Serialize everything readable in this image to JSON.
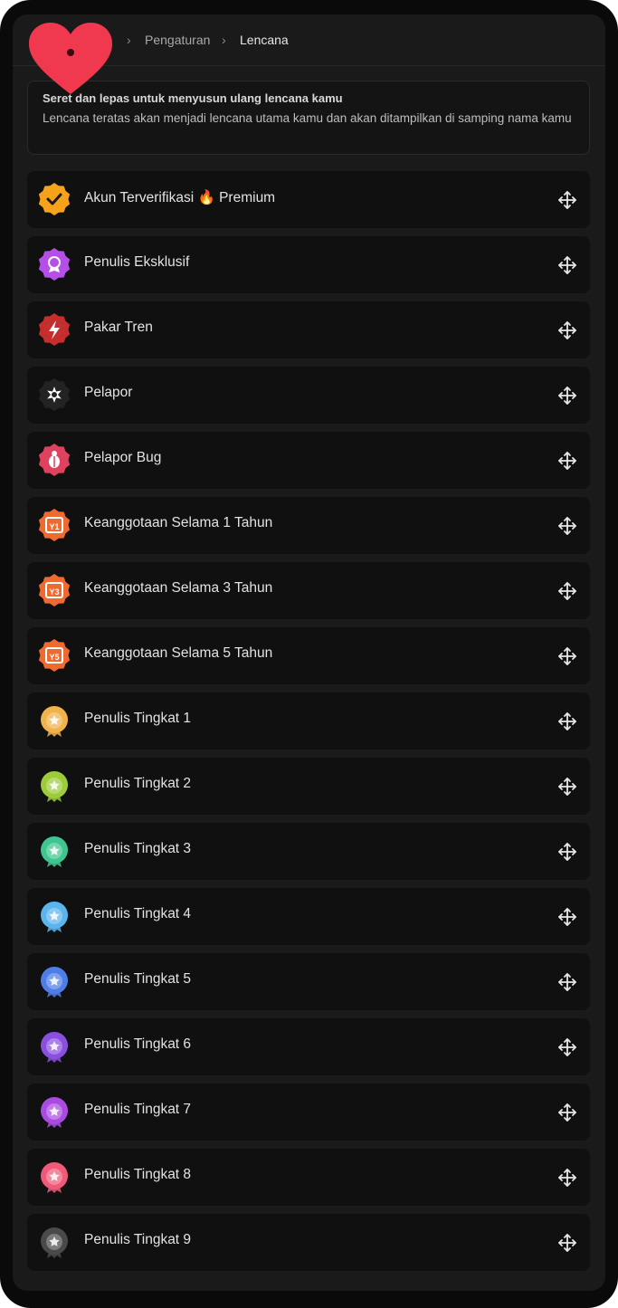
{
  "breadcrumb": {
    "home_icon": "heart-icon",
    "items": [
      "Pengaturan",
      "Lencana"
    ]
  },
  "info": {
    "title": "Seret dan lepas untuk menyusun ulang lencana kamu",
    "description": "Lencana teratas akan menjadi lencana utama kamu dan akan ditampilkan di samping nama kamu"
  },
  "badges": [
    {
      "label": "Akun Terverifikasi 🔥 Premium",
      "icon": "verified-badge-icon",
      "color": "#f7a21b"
    },
    {
      "label": "Penulis Eksklusif",
      "icon": "exclusive-writer-badge-icon",
      "color": "#b64ee8"
    },
    {
      "label": "Pakar Tren",
      "icon": "trend-expert-badge-icon",
      "color": "#c62d2d"
    },
    {
      "label": "Pelapor",
      "icon": "reporter-badge-icon",
      "color": "#232323"
    },
    {
      "label": "Pelapor Bug",
      "icon": "bug-reporter-badge-icon",
      "color": "#e0415e"
    },
    {
      "label": "Keanggotaan Selama 1 Tahun",
      "icon": "membership-1-year-badge-icon",
      "color": "#ee6a30",
      "short": "Y1"
    },
    {
      "label": "Keanggotaan Selama 3 Tahun",
      "icon": "membership-3-year-badge-icon",
      "color": "#ee6a30",
      "short": "Y3"
    },
    {
      "label": "Keanggotaan Selama 5 Tahun",
      "icon": "membership-5-year-badge-icon",
      "color": "#ee6a30",
      "short": "Y5"
    },
    {
      "label": "Penulis Tingkat 1",
      "icon": "writer-level-1-badge-icon",
      "color": "#f0b24a"
    },
    {
      "label": "Penulis Tingkat 2",
      "icon": "writer-level-2-badge-icon",
      "color": "#9ccc3a"
    },
    {
      "label": "Penulis Tingkat 3",
      "icon": "writer-level-3-badge-icon",
      "color": "#3fc58f"
    },
    {
      "label": "Penulis Tingkat 4",
      "icon": "writer-level-4-badge-icon",
      "color": "#5ab4ee"
    },
    {
      "label": "Penulis Tingkat 5",
      "icon": "writer-level-5-badge-icon",
      "color": "#4f7de8"
    },
    {
      "label": "Penulis Tingkat 6",
      "icon": "writer-level-6-badge-icon",
      "color": "#8b4fe0"
    },
    {
      "label": "Penulis Tingkat 7",
      "icon": "writer-level-7-badge-icon",
      "color": "#a94be0"
    },
    {
      "label": "Penulis Tingkat 8",
      "icon": "writer-level-8-badge-icon",
      "color": "#f05a7a"
    },
    {
      "label": "Penulis Tingkat 9",
      "icon": "writer-level-9-badge-icon",
      "color": "#4a4a4a"
    }
  ],
  "drag_icon": "drag-move-icon"
}
